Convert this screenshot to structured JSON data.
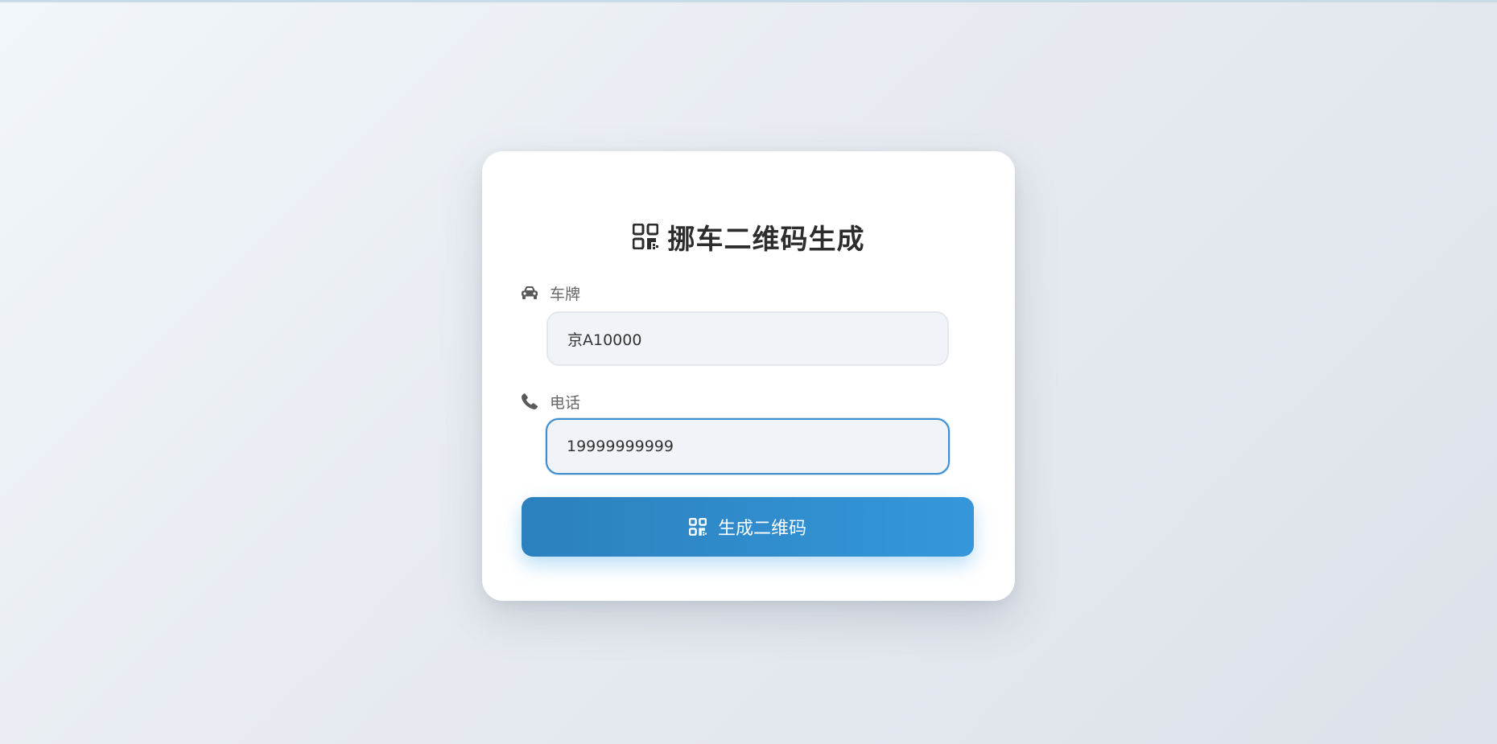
{
  "form": {
    "title": "挪车二维码生成",
    "title_icon": "qrcode-icon",
    "plate": {
      "label": "车牌",
      "icon": "car-icon",
      "value": "京A10000"
    },
    "phone": {
      "label": "电话",
      "icon": "phone-icon",
      "value": "19999999999"
    },
    "submit": {
      "label": "生成二维码",
      "icon": "qrcode-icon"
    }
  },
  "colors": {
    "accent": "#3b8fd0",
    "button_start": "#2b80bd",
    "button_end": "#3597da",
    "title_text": "#2d2d2d",
    "label_text": "#666666"
  }
}
